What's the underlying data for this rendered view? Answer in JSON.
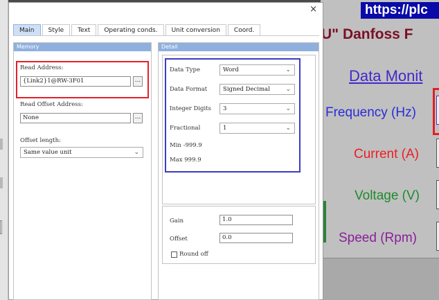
{
  "dialog": {
    "close_glyph": "×",
    "tabs": [
      "Main",
      "Style",
      "Text",
      "Operating conds.",
      "Unit conversion",
      "Coord."
    ],
    "memory": {
      "title": "Memory",
      "read_address_label": "Read Address:",
      "read_address_value": "{Link2}1@RW-3F01",
      "read_offset_label": "Read Offset Address:",
      "read_offset_value": "None",
      "offset_length_label": "Offset length:",
      "offset_length_value": "Same value unit",
      "browse_glyph": "..."
    },
    "detail": {
      "title": "Detail",
      "data_type_label": "Data Type",
      "data_type_value": "Word",
      "data_format_label": "Data Format",
      "data_format_value": "Signed Decimal",
      "integer_digits_label": "Integer Digits",
      "integer_digits_value": "3",
      "fractional_label": "Fractional",
      "fractional_value": "1",
      "min_text": "Min -999.9",
      "max_text": "Max 999.9",
      "gain_label": "Gain",
      "gain_value": "1.0",
      "offset_label": "Offset",
      "offset_value": "0.0",
      "round_off_label": "Round off",
      "round_off_checked": false
    }
  },
  "hmi": {
    "url": "https://plc",
    "title": "U\" Danfoss F",
    "subtitle": "Data Monit",
    "labels": [
      {
        "text": "Frequency (Hz)",
        "color": "#2b2bd6"
      },
      {
        "text": "Current (A)",
        "color": "#ee1c24"
      },
      {
        "text": "Voltage (V)",
        "color": "#1e8a2c"
      },
      {
        "text": "Speed (Rpm)",
        "color": "#8a1f9a"
      }
    ]
  }
}
